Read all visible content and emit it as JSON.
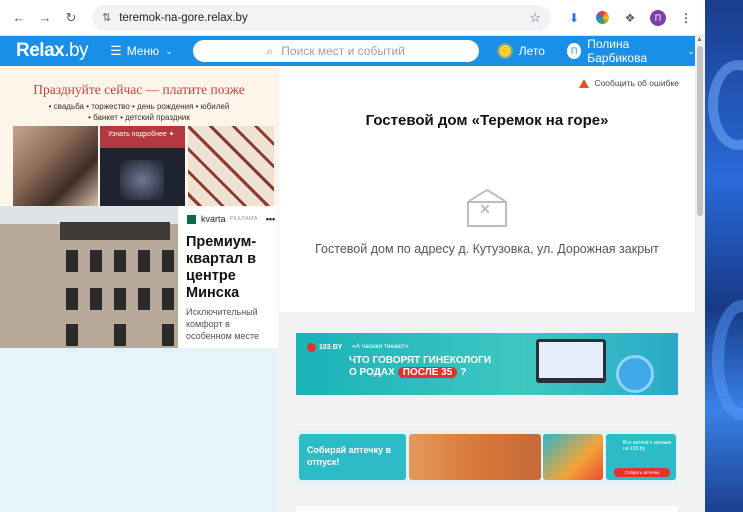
{
  "browser": {
    "url": "teremok-na-gore.relax.by",
    "back_icon": "←",
    "forward_icon": "→",
    "reload_icon": "↻",
    "tune_icon": "⇅",
    "star_icon": "☆",
    "download_icon": "⬇",
    "puzzle_icon": "❖",
    "profile_initial": "П",
    "kebab_icon": "⋮"
  },
  "header": {
    "logo_main": "Relax",
    "logo_dot": ".by",
    "menu_label": "Меню",
    "menu_burger": "☰",
    "menu_chevron": "⌄",
    "search_placeholder": "Поиск мест и событий",
    "search_icon": "⌕",
    "weather_label": "Лето",
    "user_initial": "П",
    "user_name": "Полина Барбикова",
    "user_chevron": "⌄",
    "accent_color": "#1a8fe8"
  },
  "ad_wedding": {
    "headline": "Празднуйте сейчас — платите позже",
    "line1": "• свадьба • торжество • день рождения • юбилей",
    "line2": "• банкет • детский праздник",
    "button": "Узнать подробнее ✦"
  },
  "ad_kvartal": {
    "brand": "kvarta",
    "label": "РЕКЛАМА",
    "more": "•••",
    "title": "Премиум-квартал в центре Минска",
    "desc": "Исключительный комфорт в особенном месте"
  },
  "place": {
    "report_label": "Сообщить об ошибке",
    "title": "Гостевой дом «Теремок на горе»",
    "no_image_icon": "✕",
    "address_text": "Гостевой дом по адресу д. Кутузовка, ул. Дорожная закрыт"
  },
  "banner_103": {
    "logo": "103.BY",
    "tag": "«А часики тикают»",
    "line1": "ЧТО ГОВОРЯТ ГИНЕКОЛОГИ",
    "line2_pre": "О РОДАХ",
    "badge": "ПОСЛЕ 35",
    "line2_post": "?"
  },
  "banner_pharmacy": {
    "text": "Собирай аптечку в отпуск!",
    "side_text": "Все аптеки с ценами на 103.by",
    "button": "Собрать аптечку"
  }
}
